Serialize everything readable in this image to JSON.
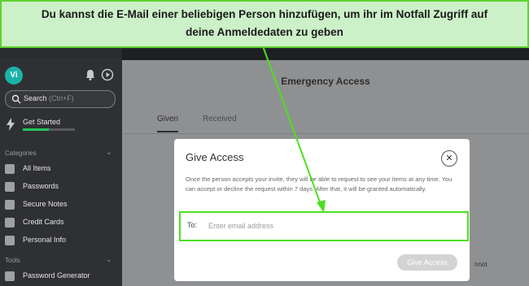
{
  "annotation": {
    "line1": "Du kannst die E-Mail einer beliebigen Person hinzufügen, um ihr im Notfall Zugriff auf",
    "line2": "deine Anmeldedaten zu geben"
  },
  "app": {
    "avatar_initials": "Vi",
    "search_label": "Search",
    "search_shortcut": "(Ctrl+F)",
    "get_started": {
      "label": "Get Started",
      "progress": 0.5
    },
    "categories_heading": "Categories",
    "tools_heading": "Tools",
    "sidebar_items": [
      {
        "label": "All Items",
        "icon": "grid-icon"
      },
      {
        "label": "Passwords",
        "icon": "password-icon"
      },
      {
        "label": "Secure Notes",
        "icon": "note-icon"
      },
      {
        "label": "Credit Cards",
        "icon": "credit-card-icon"
      },
      {
        "label": "Personal Info",
        "icon": "person-icon"
      }
    ],
    "tool_items": [
      {
        "label": "Password Generator",
        "icon": "generator-icon"
      }
    ]
  },
  "main": {
    "title": "Emergency Access",
    "tabs": [
      {
        "label": "Given",
        "active": true
      },
      {
        "label": "Received",
        "active": false
      }
    ],
    "underlying_text": "nnot"
  },
  "modal": {
    "title": "Give Access",
    "description": "Once the person accepts your invite, they will be able to request to see your items at any time. You can accept or decline the request within 7 days. After that, it will be granted automatically.",
    "to_label": "To:",
    "email_placeholder": "Enter email address",
    "email_value": "",
    "submit_label": "Give Access"
  },
  "colors": {
    "annotation_border": "#5fd22e",
    "annotation_fill": "#ccf0c8",
    "avatar": "#1ab3a8",
    "progress": "#22c55e"
  }
}
